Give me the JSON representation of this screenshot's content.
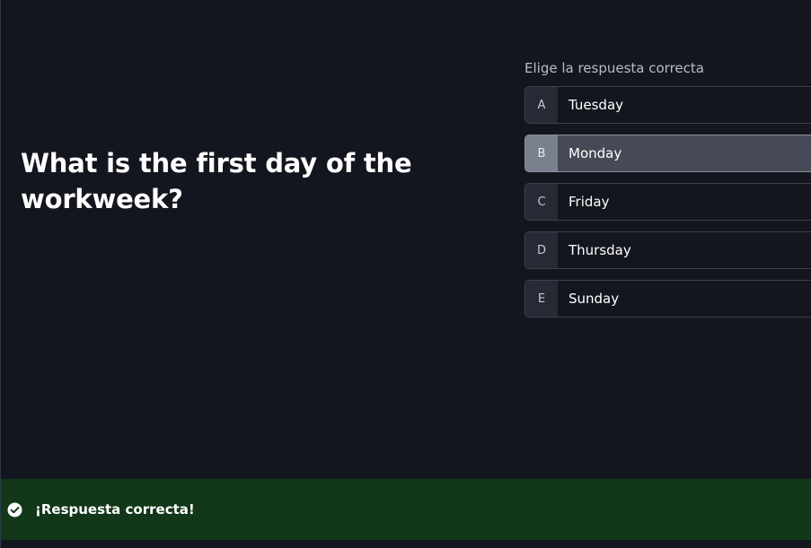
{
  "question": {
    "text": "What is the first day of the workweek?"
  },
  "answers": {
    "prompt": "Elige la respuesta correcta",
    "options": [
      {
        "letter": "A",
        "label": "Tuesday",
        "selected": false
      },
      {
        "letter": "B",
        "label": "Monday",
        "selected": true
      },
      {
        "letter": "C",
        "label": "Friday",
        "selected": false
      },
      {
        "letter": "D",
        "label": "Thursday",
        "selected": false
      },
      {
        "letter": "E",
        "label": "Sunday",
        "selected": false
      }
    ]
  },
  "feedback": {
    "icon": "check-circle-icon",
    "text": "¡Respuesta correcta!",
    "color": "#133719"
  },
  "theme": {
    "background": "#14161f",
    "selected_option_bg": "#464a56"
  }
}
